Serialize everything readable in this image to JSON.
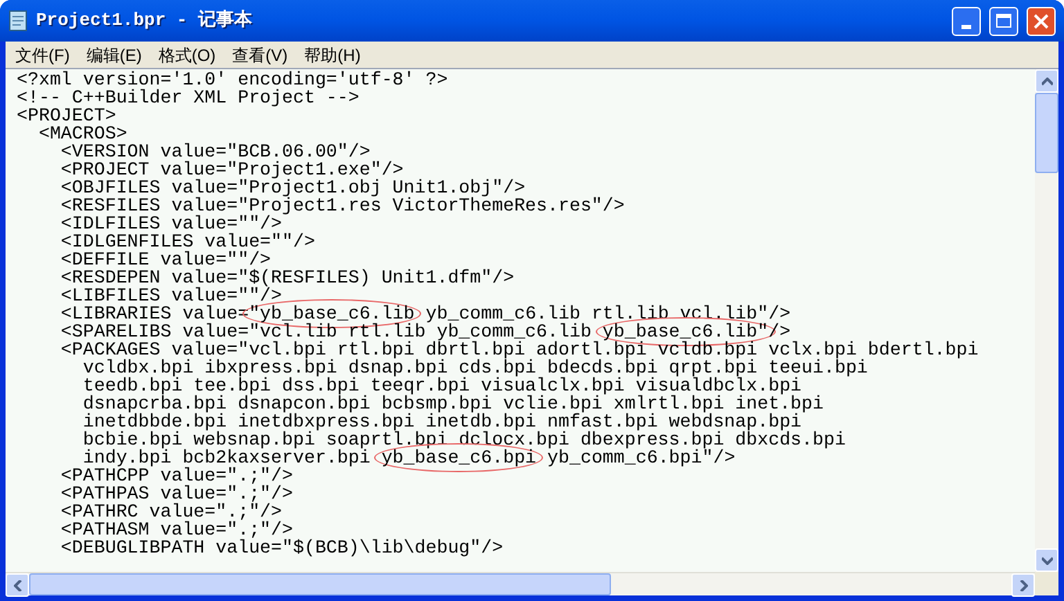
{
  "window": {
    "title": "Project1.bpr - 记事本"
  },
  "menu": [
    "文件(F)",
    "编辑(E)",
    "格式(O)",
    "查看(V)",
    "帮助(H)"
  ],
  "lines": [
    {
      "text": "<?xml version='1.0' encoding='utf-8' ?>"
    },
    {
      "text": "<!-- C++Builder XML Project -->"
    },
    {
      "text": "<PROJECT>"
    },
    {
      "text": "  <MACROS>"
    },
    {
      "text": "    <VERSION value=\"BCB.06.00\"/>"
    },
    {
      "text": "    <PROJECT value=\"Project1.exe\"/>"
    },
    {
      "text": "    <OBJFILES value=\"Project1.obj Unit1.obj\"/>"
    },
    {
      "text": "    <RESFILES value=\"Project1.res VictorThemeRes.res\"/>"
    },
    {
      "text": "    <IDLFILES value=\"\"/>"
    },
    {
      "text": "    <IDLGENFILES value=\"\"/>"
    },
    {
      "text": "    <DEFFILE value=\"\"/>"
    },
    {
      "text": "    <RESDEPEN value=\"$(RESFILES) Unit1.dfm\"/>"
    },
    {
      "text": "    <LIBFILES value=\"\"/>"
    },
    {
      "segments": [
        {
          "text": "    <LIBRARIES value=",
          "circled": false
        },
        {
          "text": "\"yb_base_c6.lib",
          "circled": true
        },
        {
          "text": " yb_comm_c6.lib rtl.lib vcl.lib\"/>",
          "circled": false
        }
      ]
    },
    {
      "segments": [
        {
          "text": "    <SPARELIBS value=\"vcl.lib rtl.lib yb_comm_c6.lib ",
          "circled": false
        },
        {
          "text": "yb_base_c6.lib\"",
          "circled": true
        },
        {
          "text": "/>",
          "circled": false
        }
      ]
    },
    {
      "text": "    <PACKAGES value=\"vcl.bpi rtl.bpi dbrtl.bpi adortl.bpi vcldb.bpi vclx.bpi bdertl.bpi"
    },
    {
      "text": "      vcldbx.bpi ibxpress.bpi dsnap.bpi cds.bpi bdecds.bpi qrpt.bpi teeui.bpi"
    },
    {
      "text": "      teedb.bpi tee.bpi dss.bpi teeqr.bpi visualclx.bpi visualdbclx.bpi"
    },
    {
      "text": "      dsnapcrba.bpi dsnapcon.bpi bcbsmp.bpi vclie.bpi xmlrtl.bpi inet.bpi"
    },
    {
      "text": "      inetdbbde.bpi inetdbxpress.bpi inetdb.bpi nmfast.bpi webdsnap.bpi"
    },
    {
      "text": "      bcbie.bpi websnap.bpi soaprtl.bpi dclocx.bpi dbexpress.bpi dbxcds.bpi"
    },
    {
      "segments": [
        {
          "text": "      indy.bpi bcb2kaxserver.bpi ",
          "circled": false
        },
        {
          "text": "yb_base_c6.bpi",
          "circled": true
        },
        {
          "text": " yb_comm_c6.bpi\"/>",
          "circled": false
        }
      ]
    },
    {
      "text": "    <PATHCPP value=\".;\"/>"
    },
    {
      "text": "    <PATHPAS value=\".;\"/>"
    },
    {
      "text": "    <PATHRC value=\".;\"/>"
    },
    {
      "text": "    <PATHASM value=\".;\"/>"
    },
    {
      "text": "    <DEBUGLIBPATH value=\"$(BCB)\\lib\\debug\"/>"
    }
  ]
}
